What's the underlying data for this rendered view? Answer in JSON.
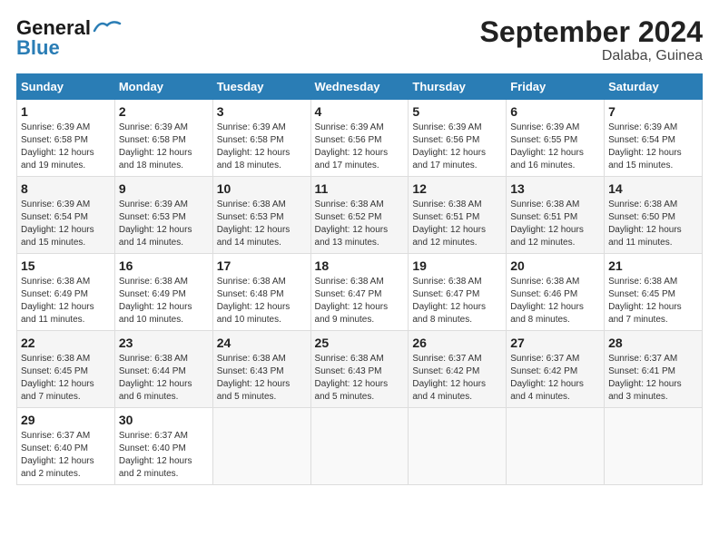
{
  "logo": {
    "line1": "General",
    "line2": "Blue"
  },
  "title": "September 2024",
  "subtitle": "Dalaba, Guinea",
  "days_of_week": [
    "Sunday",
    "Monday",
    "Tuesday",
    "Wednesday",
    "Thursday",
    "Friday",
    "Saturday"
  ],
  "weeks": [
    [
      {
        "day": "1",
        "rise": "6:39 AM",
        "set": "6:58 PM",
        "hours": "12 hours and 19 minutes."
      },
      {
        "day": "2",
        "rise": "6:39 AM",
        "set": "6:58 PM",
        "hours": "12 hours and 18 minutes."
      },
      {
        "day": "3",
        "rise": "6:39 AM",
        "set": "6:58 PM",
        "hours": "12 hours and 18 minutes."
      },
      {
        "day": "4",
        "rise": "6:39 AM",
        "set": "6:56 PM",
        "hours": "12 hours and 17 minutes."
      },
      {
        "day": "5",
        "rise": "6:39 AM",
        "set": "6:56 PM",
        "hours": "12 hours and 17 minutes."
      },
      {
        "day": "6",
        "rise": "6:39 AM",
        "set": "6:55 PM",
        "hours": "12 hours and 16 minutes."
      },
      {
        "day": "7",
        "rise": "6:39 AM",
        "set": "6:54 PM",
        "hours": "12 hours and 15 minutes."
      }
    ],
    [
      {
        "day": "8",
        "rise": "6:39 AM",
        "set": "6:54 PM",
        "hours": "12 hours and 15 minutes."
      },
      {
        "day": "9",
        "rise": "6:39 AM",
        "set": "6:53 PM",
        "hours": "12 hours and 14 minutes."
      },
      {
        "day": "10",
        "rise": "6:38 AM",
        "set": "6:53 PM",
        "hours": "12 hours and 14 minutes."
      },
      {
        "day": "11",
        "rise": "6:38 AM",
        "set": "6:52 PM",
        "hours": "12 hours and 13 minutes."
      },
      {
        "day": "12",
        "rise": "6:38 AM",
        "set": "6:51 PM",
        "hours": "12 hours and 12 minutes."
      },
      {
        "day": "13",
        "rise": "6:38 AM",
        "set": "6:51 PM",
        "hours": "12 hours and 12 minutes."
      },
      {
        "day": "14",
        "rise": "6:38 AM",
        "set": "6:50 PM",
        "hours": "12 hours and 11 minutes."
      }
    ],
    [
      {
        "day": "15",
        "rise": "6:38 AM",
        "set": "6:49 PM",
        "hours": "12 hours and 11 minutes."
      },
      {
        "day": "16",
        "rise": "6:38 AM",
        "set": "6:49 PM",
        "hours": "12 hours and 10 minutes."
      },
      {
        "day": "17",
        "rise": "6:38 AM",
        "set": "6:48 PM",
        "hours": "12 hours and 10 minutes."
      },
      {
        "day": "18",
        "rise": "6:38 AM",
        "set": "6:47 PM",
        "hours": "12 hours and 9 minutes."
      },
      {
        "day": "19",
        "rise": "6:38 AM",
        "set": "6:47 PM",
        "hours": "12 hours and 8 minutes."
      },
      {
        "day": "20",
        "rise": "6:38 AM",
        "set": "6:46 PM",
        "hours": "12 hours and 8 minutes."
      },
      {
        "day": "21",
        "rise": "6:38 AM",
        "set": "6:45 PM",
        "hours": "12 hours and 7 minutes."
      }
    ],
    [
      {
        "day": "22",
        "rise": "6:38 AM",
        "set": "6:45 PM",
        "hours": "12 hours and 7 minutes."
      },
      {
        "day": "23",
        "rise": "6:38 AM",
        "set": "6:44 PM",
        "hours": "12 hours and 6 minutes."
      },
      {
        "day": "24",
        "rise": "6:38 AM",
        "set": "6:43 PM",
        "hours": "12 hours and 5 minutes."
      },
      {
        "day": "25",
        "rise": "6:38 AM",
        "set": "6:43 PM",
        "hours": "12 hours and 5 minutes."
      },
      {
        "day": "26",
        "rise": "6:37 AM",
        "set": "6:42 PM",
        "hours": "12 hours and 4 minutes."
      },
      {
        "day": "27",
        "rise": "6:37 AM",
        "set": "6:42 PM",
        "hours": "12 hours and 4 minutes."
      },
      {
        "day": "28",
        "rise": "6:37 AM",
        "set": "6:41 PM",
        "hours": "12 hours and 3 minutes."
      }
    ],
    [
      {
        "day": "29",
        "rise": "6:37 AM",
        "set": "6:40 PM",
        "hours": "12 hours and 2 minutes."
      },
      {
        "day": "30",
        "rise": "6:37 AM",
        "set": "6:40 PM",
        "hours": "12 hours and 2 minutes."
      },
      null,
      null,
      null,
      null,
      null
    ]
  ],
  "labels": {
    "sunrise": "Sunrise:",
    "sunset": "Sunset:",
    "daylight": "Daylight:"
  }
}
